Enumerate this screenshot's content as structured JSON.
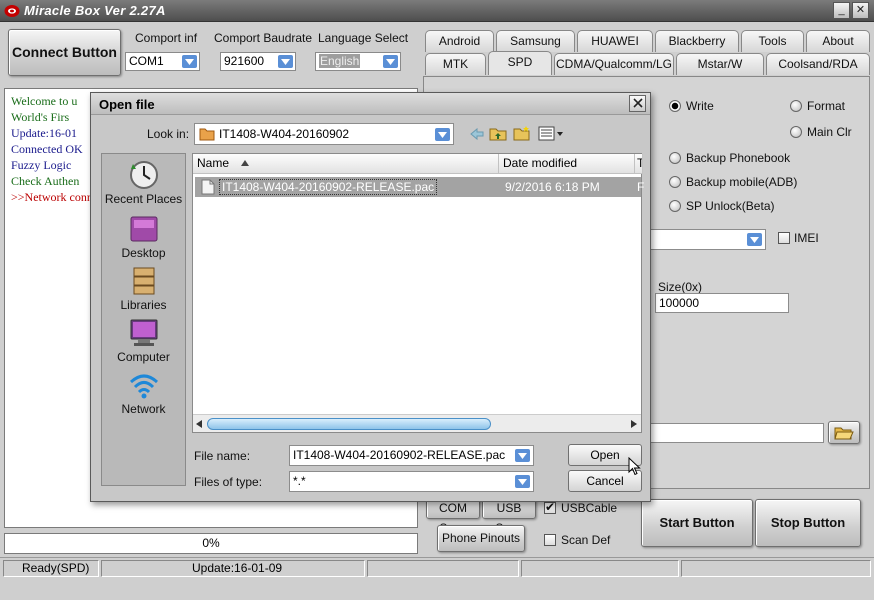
{
  "window": {
    "title": "Miracle Box Ver 2.27A",
    "min": "_",
    "close": "✕"
  },
  "connect_label": "Connect Button",
  "comport": {
    "label": "Comport inf",
    "value": "COM1"
  },
  "baud": {
    "label": "Comport Baudrate",
    "value": "921600"
  },
  "language": {
    "label": "Language Select",
    "value": "English"
  },
  "tabs_row1": [
    "Android",
    "Samsung",
    "HUAWEI",
    "Blackberry",
    "Tools",
    "About"
  ],
  "tabs_row2": [
    "MTK",
    "SPD",
    "CDMA/Qualcomm/LG",
    "Mstar/W",
    "Coolsand/RDA"
  ],
  "active_tab": "SPD",
  "options": {
    "write": "Write",
    "format": "Format",
    "main_clr": "Main Clr",
    "backup_phonebook": "Backup Phonebook",
    "backup_mobile": "Backup mobile(ADB)",
    "sp_unlock": "SP Unlock(Beta)",
    "imei": "IMEI",
    "size_label": "Size(0x)",
    "size_value": "100000"
  },
  "buttons": {
    "com_scan": "COM Scan",
    "usb_scan": "USB Scan",
    "usb_cable": "USBCable",
    "phone_pinouts": "Phone Pinouts",
    "scan_def": "Scan Def",
    "start": "Start Button",
    "stop": "Stop Button"
  },
  "log": [
    {
      "text": "Welcome to u",
      "color": "green"
    },
    {
      "text": "World's Firs",
      "color": "green"
    },
    {
      "text": "Update:16-01",
      "color": "blue"
    },
    {
      "text": "Connected OK",
      "color": "blue"
    },
    {
      "text": "Fuzzy Logic",
      "color": "blue"
    },
    {
      "text": "Check Authen",
      "color": "green"
    },
    {
      "text": ">>Network conn",
      "color": "red"
    }
  ],
  "progress": "0%",
  "status": {
    "mode": "Ready(SPD)",
    "update": "Update:16-01-09"
  },
  "dialog": {
    "title": "Open file",
    "look_in_label": "Look in:",
    "look_in_value": "IT1408-W404-20160902",
    "places": [
      "Recent Places",
      "Desktop",
      "Libraries",
      "Computer",
      "Network"
    ],
    "columns": {
      "name": "Name",
      "date": "Date modified",
      "type": "T"
    },
    "file": {
      "name": "IT1408-W404-20160902-RELEASE.pac",
      "date": "9/2/2016 6:18 PM",
      "type": "F"
    },
    "file_name_label": "File name:",
    "file_name_value": "IT1408-W404-20160902-RELEASE.pac",
    "file_type_label": "Files of type:",
    "file_type_value": "*.*",
    "open": "Open",
    "cancel": "Cancel"
  }
}
